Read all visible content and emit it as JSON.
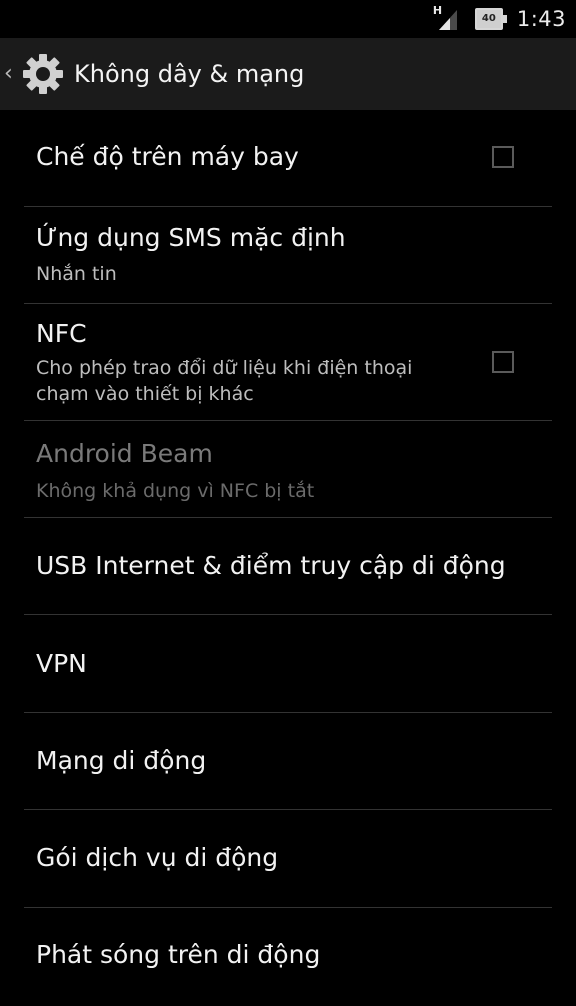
{
  "status_bar": {
    "network_label": "H",
    "battery_level": "40",
    "time": "1:43"
  },
  "action_bar": {
    "title": "Không dây & mạng",
    "icon": "settings-gear-icon"
  },
  "items": [
    {
      "title": "Chế độ trên máy bay",
      "summary": "",
      "checkbox": true,
      "checked": false,
      "enabled": true
    },
    {
      "title": "Ứng dụng SMS mặc định",
      "summary": "Nhắn tin",
      "checkbox": false,
      "enabled": true
    },
    {
      "title": "NFC",
      "summary_line1": "Cho phép trao đổi dữ liệu khi điện thoại",
      "summary_line2": "chạm vào thiết bị khác",
      "checkbox": true,
      "checked": false,
      "enabled": true
    },
    {
      "title": "Android Beam",
      "summary": "Không khả dụng vì NFC bị tắt",
      "checkbox": false,
      "enabled": false
    },
    {
      "title": "USB Internet & điểm truy cập di động",
      "summary": "",
      "checkbox": false,
      "enabled": true
    },
    {
      "title": "VPN",
      "summary": "",
      "checkbox": false,
      "enabled": true
    },
    {
      "title": "Mạng di động",
      "summary": "",
      "checkbox": false,
      "enabled": true
    },
    {
      "title": "Gói dịch vụ di động",
      "summary": "",
      "checkbox": false,
      "enabled": true
    },
    {
      "title": "Phát sóng trên di động",
      "summary": "",
      "checkbox": false,
      "enabled": true
    }
  ],
  "colors": {
    "background": "#000000",
    "action_bar": "#1b1b1b",
    "divider": "#333333",
    "primary_text": "#f2f2f2",
    "secondary_text": "#bdbdbd",
    "disabled_text": "#7a7a7a"
  }
}
